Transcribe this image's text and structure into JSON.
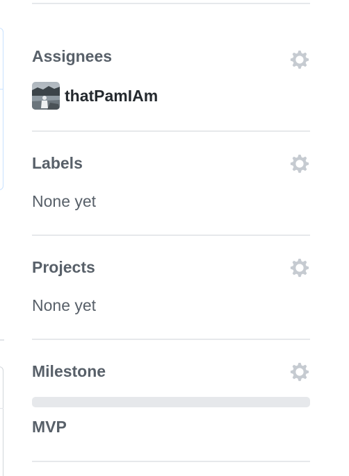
{
  "sidebar": {
    "assignees": {
      "heading": "Assignees",
      "settings_icon": "gear-icon",
      "users": [
        {
          "login": "thatPamIAm",
          "avatar": "avatar-photo"
        }
      ]
    },
    "labels": {
      "heading": "Labels",
      "settings_icon": "gear-icon",
      "value": "None yet"
    },
    "projects": {
      "heading": "Projects",
      "settings_icon": "gear-icon",
      "value": "None yet"
    },
    "milestone": {
      "heading": "Milestone",
      "settings_icon": "gear-icon",
      "progress_fraction": 0,
      "title": "MVP"
    }
  },
  "colors": {
    "heading_text": "#586069",
    "strong_text": "#24292e",
    "divider": "#e6e8eb",
    "gear": "#c6cbd1",
    "progress_track": "#e6e8eb",
    "progress_fill": "#2cbe4e",
    "focus_border": "#c8e1ff"
  }
}
